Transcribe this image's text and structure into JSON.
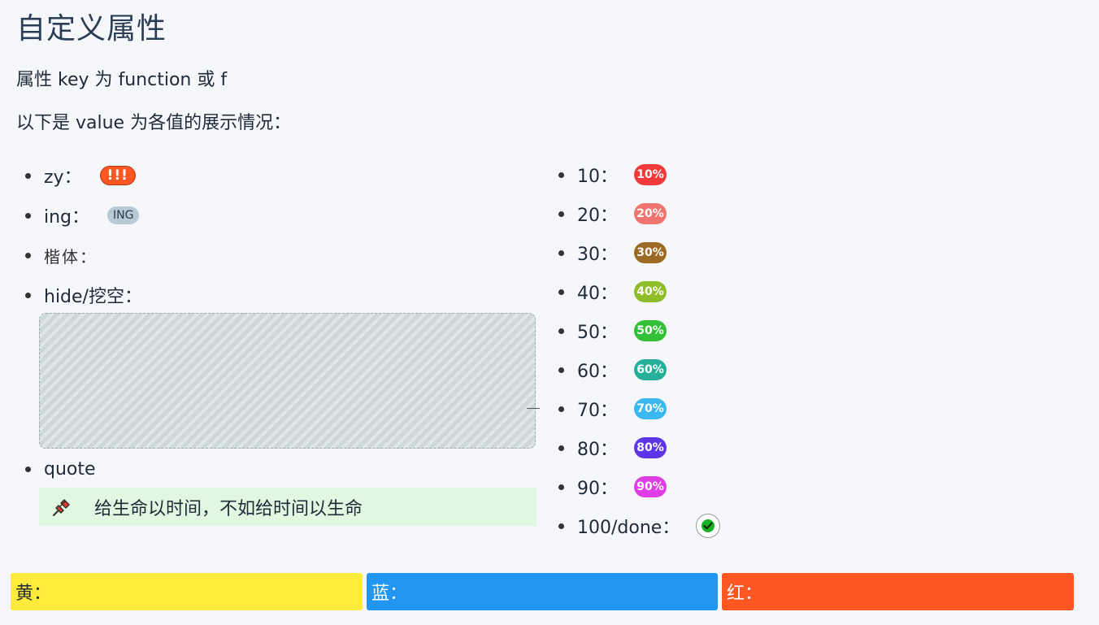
{
  "title": "自定义属性",
  "intro": "属性 key 为 function 或 f",
  "desc": "以下是 value 为各值的展示情况：",
  "left_items": {
    "zy": {
      "label": "zy：",
      "badge": "!!!",
      "color": "#ff5722"
    },
    "ing": {
      "label": "ing：",
      "badge": "ING",
      "color": "#b9c9d5"
    },
    "kai": {
      "label": "楷体："
    },
    "hide": {
      "label": "hide/挖空："
    },
    "quote": {
      "label": "quote",
      "text": "给生命以时间，不如给时间以生命",
      "icon": "pushpin-icon"
    }
  },
  "progress_items": [
    {
      "label": "10：",
      "badge": "10%",
      "value": 10,
      "color": "#f23a3a"
    },
    {
      "label": "20：",
      "badge": "20%",
      "value": 20,
      "color": "#f07470"
    },
    {
      "label": "30：",
      "badge": "30%",
      "value": 30,
      "color": "#9c6a24"
    },
    {
      "label": "40：",
      "badge": "40%",
      "value": 40,
      "color": "#8fbe2a"
    },
    {
      "label": "50：",
      "badge": "50%",
      "value": 50,
      "color": "#32c036"
    },
    {
      "label": "60：",
      "badge": "60%",
      "value": 60,
      "color": "#26b09a"
    },
    {
      "label": "70：",
      "badge": "70%",
      "value": 70,
      "color": "#3bb8ef"
    },
    {
      "label": "80：",
      "badge": "80%",
      "value": 80,
      "color": "#5e35e8"
    },
    {
      "label": "90：",
      "badge": "90%",
      "value": 90,
      "color": "#df3ee6"
    }
  ],
  "done": {
    "label": "100/done：",
    "icon": "check-circle-icon",
    "color": "#11aa22"
  },
  "color_bars": {
    "yellow": {
      "label": "黄：",
      "color": "#ffeb3b"
    },
    "blue": {
      "label": "蓝：",
      "color": "#2196f3"
    },
    "red": {
      "label": "红：",
      "color": "#ff5722"
    }
  }
}
